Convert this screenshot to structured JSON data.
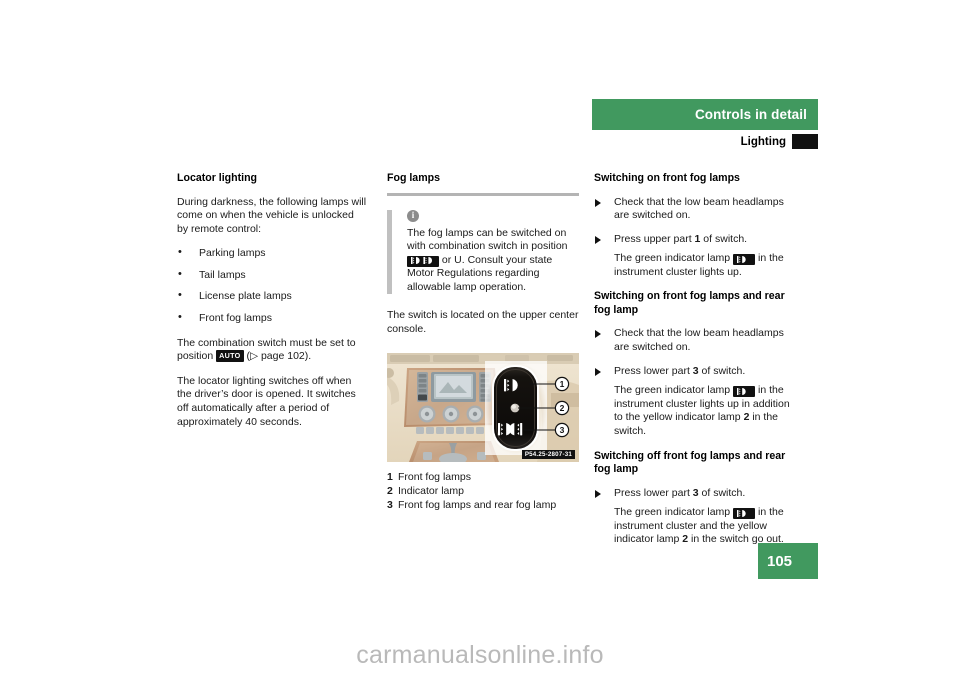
{
  "header": {
    "chapter_title": "Controls in detail",
    "section_title": "Lighting"
  },
  "page_number": "105",
  "watermark": "carmanualsonline.info",
  "left_column": {
    "heading": "Locator lighting",
    "intro": "During darkness, the following lamps will come on when the vehicle is unlocked by remote control:",
    "bullets": [
      "Parking lamps",
      "Tail lamps",
      "License plate lamps",
      "Front fog lamps"
    ],
    "switch_note_before": "The combination switch must be set to position ",
    "auto_badge": "AUTO",
    "switch_note_after": " (▷ page 102).",
    "closing": "The locator lighting switches off when the driver’s door is opened. It switches off automatically after a period of approximately 40 seconds."
  },
  "middle_column": {
    "heading": "Fog lamps",
    "note_icon": "info-icon",
    "note_text_1": "The fog lamps can be switched on with combination switch in position ",
    "note_badge": "fog-lamp-symbol",
    "note_text_2": " or U. Consult your state Motor Regulations regarding allowable lamp operation.",
    "location_text": "The switch is located on the upper center console.",
    "figure": {
      "code": "P54.25-2807-31",
      "callouts": [
        "1",
        "2",
        "3"
      ]
    },
    "legend": [
      {
        "num": "1",
        "text": "Front fog lamps"
      },
      {
        "num": "2",
        "text": "Indicator lamp"
      },
      {
        "num": "3",
        "text": "Front fog lamps and rear fog lamp"
      }
    ]
  },
  "right_column": {
    "section_1": {
      "heading": "Switching on front fog lamps",
      "steps": [
        "Check that the low beam headlamps are switched on.",
        "Press upper part 1 of switch."
      ],
      "result_before": "The green indicator lamp ",
      "result_badge": "green-fog-indicator",
      "result_after": " in the instrument cluster lights up."
    },
    "section_2": {
      "heading": "Switching on front fog lamps and rear fog lamp",
      "steps": [
        "Check that the low beam headlamps are switched on.",
        "Press lower part 3 of switch."
      ],
      "result_before": "The green indicator lamp ",
      "result_badge": "green-fog-indicator",
      "result_after": " in the instrument cluster lights up in addition to the yellow indicator lamp 2 in the switch."
    },
    "section_3": {
      "heading": "Switching off front fog lamps and rear fog lamp",
      "steps": [
        "Press lower part 3 of switch."
      ],
      "result_before": "The green indicator lamp ",
      "result_badge": "green-fog-indicator",
      "result_after": " in the instrument cluster and the yellow indicator lamp 2 in the switch go out."
    }
  },
  "colors": {
    "accent_green": "#41995f",
    "badge_black": "#111111",
    "rule_gray": "#b4b4b4"
  }
}
